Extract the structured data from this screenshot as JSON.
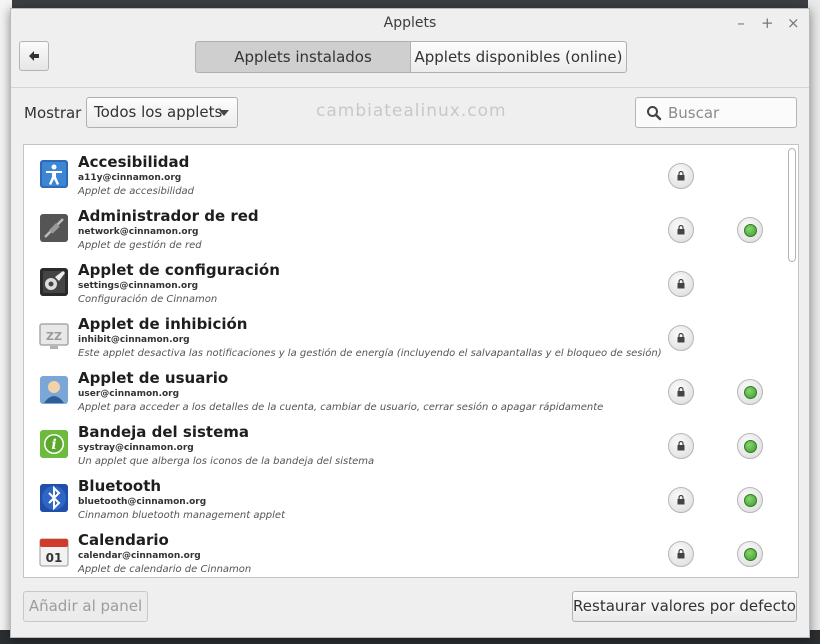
{
  "window": {
    "title": "Applets"
  },
  "wm": {
    "minimize": "–",
    "maximize": "+",
    "close": "×"
  },
  "tabs": [
    {
      "label": "Applets instalados",
      "active": true
    },
    {
      "label": "Applets disponibles (online)",
      "active": false
    }
  ],
  "filter": {
    "label": "Mostrar",
    "selected": "Todos los applets"
  },
  "watermark": "cambiatealinux.com",
  "search": {
    "placeholder": "Buscar"
  },
  "applets": [
    {
      "name": "Accesibilidad",
      "uuid": "a11y@cinnamon.org",
      "description": "Applet de accesibilidad",
      "icon": "accessibility-icon",
      "locked": true,
      "active": false
    },
    {
      "name": "Administrador de red",
      "uuid": "network@cinnamon.org",
      "description": "Applet de gestión de red",
      "icon": "network-icon",
      "locked": true,
      "active": true
    },
    {
      "name": "Applet de configuración",
      "uuid": "settings@cinnamon.org",
      "description": "Configuración de Cinnamon",
      "icon": "settings-icon",
      "locked": true,
      "active": false
    },
    {
      "name": "Applet de inhibición",
      "uuid": "inhibit@cinnamon.org",
      "description": "Este applet desactiva las notificaciones y la gestión de energía (incluyendo el salvapantallas y el bloqueo de sesión)",
      "icon": "inhibit-icon",
      "locked": true,
      "active": false
    },
    {
      "name": "Applet de usuario",
      "uuid": "user@cinnamon.org",
      "description": "Applet para acceder a los detalles de la cuenta, cambiar de usuario, cerrar sesión o apagar rápidamente",
      "icon": "user-icon",
      "locked": true,
      "active": true
    },
    {
      "name": "Bandeja del sistema",
      "uuid": "systray@cinnamon.org",
      "description": "Un applet que alberga los iconos de la bandeja del sistema",
      "icon": "info-icon",
      "locked": true,
      "active": true
    },
    {
      "name": "Bluetooth",
      "uuid": "bluetooth@cinnamon.org",
      "description": "Cinnamon bluetooth management applet",
      "icon": "bluetooth-icon",
      "locked": true,
      "active": true
    },
    {
      "name": "Calendario",
      "uuid": "calendar@cinnamon.org",
      "description": "Applet de calendario de Cinnamon",
      "icon": "calendar-icon",
      "locked": true,
      "active": true
    }
  ],
  "calendar_icon_text": "01",
  "inhibit_icon_text": "ZZ",
  "footer": {
    "add_label": "Añadir al panel",
    "restore_label": "Restaurar valores por defecto"
  }
}
